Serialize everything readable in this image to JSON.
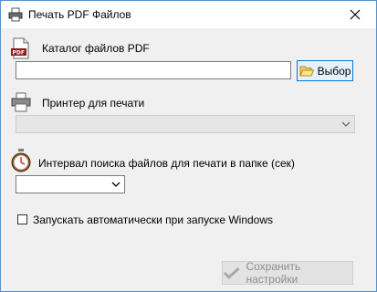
{
  "window": {
    "title": "Печать PDF Файлов"
  },
  "pdf_folder": {
    "label": "Каталог файлов PDF",
    "value": "",
    "browse_label": "Выбор"
  },
  "printer": {
    "label": "Принтер для печати",
    "selected": ""
  },
  "interval": {
    "label": "Интервал поиска файлов для печати в папке (сек)",
    "selected": ""
  },
  "autostart": {
    "label": "Запускать автоматически при запуске Windows",
    "checked": false
  },
  "save": {
    "label": "Сохранить настройки"
  },
  "icons": {
    "app": "printer-icon",
    "pdf": "pdf-file-icon",
    "printer": "printer-icon",
    "timer": "stopwatch-icon",
    "browse": "folder-icon",
    "save": "checkmark-icon"
  }
}
